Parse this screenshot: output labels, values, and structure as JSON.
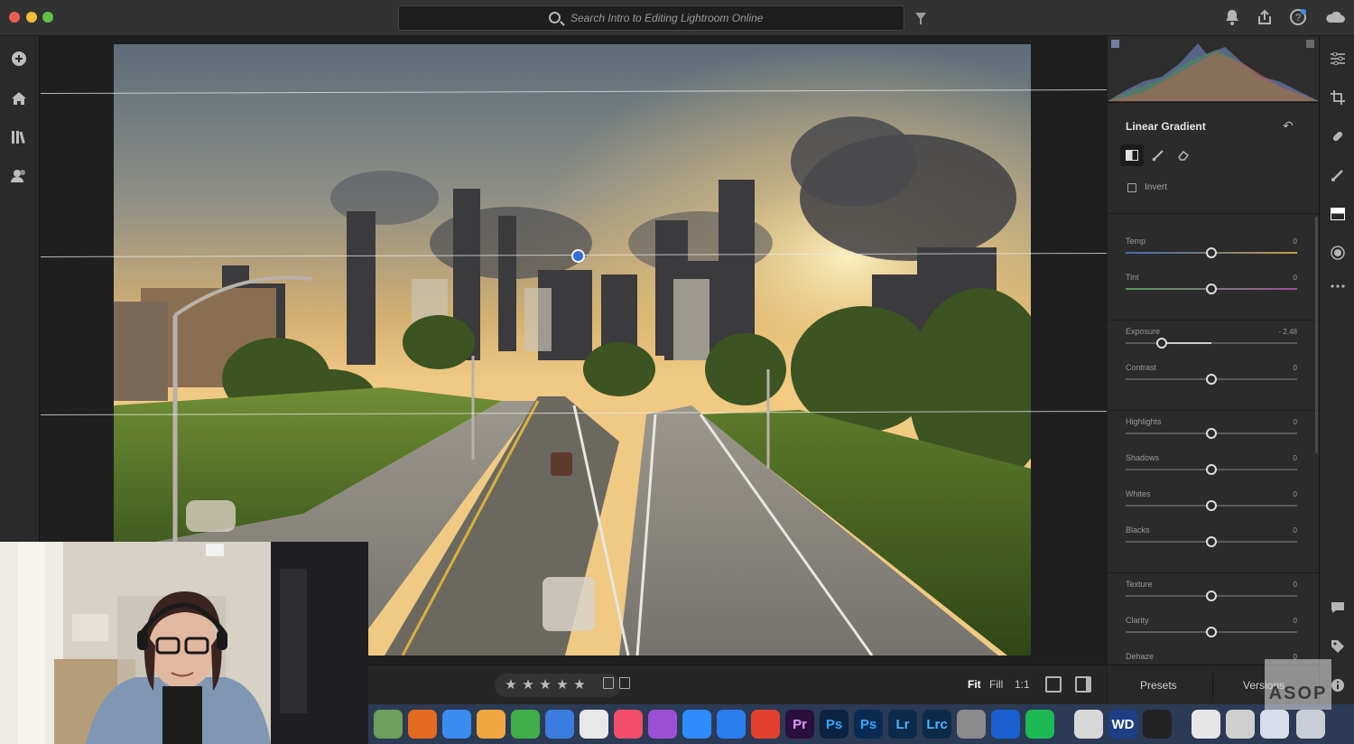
{
  "search": {
    "placeholder": "Search Intro to Editing Lightroom Online"
  },
  "panel": {
    "title": "Linear Gradient",
    "invert_label": "Invert",
    "sliders": [
      {
        "label": "Temp",
        "value": "0",
        "level": 0.5
      },
      {
        "label": "Tint",
        "value": "0",
        "level": 0.5
      },
      {
        "label": "Exposure",
        "value": "- 2.48",
        "level": 0.21
      },
      {
        "label": "Contrast",
        "value": "0",
        "level": 0.5
      },
      {
        "label": "Highlights",
        "value": "0",
        "level": 0.5
      },
      {
        "label": "Shadows",
        "value": "0",
        "level": 0.5
      },
      {
        "label": "Whites",
        "value": "0",
        "level": 0.5
      },
      {
        "label": "Blacks",
        "value": "0",
        "level": 0.5
      },
      {
        "label": "Texture",
        "value": "0",
        "level": 0.5
      },
      {
        "label": "Clarity",
        "value": "0",
        "level": 0.5
      },
      {
        "label": "Dehaze",
        "value": "0",
        "level": 0.5
      }
    ]
  },
  "toolbar": {
    "stars": [
      "★",
      "★",
      "★",
      "★",
      "★"
    ],
    "zoom_fit": "Fit",
    "zoom_fill": "Fill",
    "zoom_1to1": "1:1"
  },
  "panel_footer": {
    "presets": "Presets",
    "versions": "Versions"
  },
  "watermark": "ASOP",
  "dock": {
    "items": [
      {
        "name": "maps",
        "label": "",
        "color": "#6d9e5a"
      },
      {
        "name": "firefox",
        "label": "",
        "color": "#e46a1f"
      },
      {
        "name": "messages",
        "label": "",
        "color": "#3a8cf0"
      },
      {
        "name": "pages",
        "label": "",
        "color": "#f0a640"
      },
      {
        "name": "numbers",
        "label": "",
        "color": "#3fae4a"
      },
      {
        "name": "keynote",
        "label": "",
        "color": "#3a7be0"
      },
      {
        "name": "news",
        "label": "",
        "color": "#e8e8e8"
      },
      {
        "name": "music",
        "label": "",
        "color": "#f14d6a"
      },
      {
        "name": "podcasts",
        "label": "",
        "color": "#9c4fd6"
      },
      {
        "name": "zoom",
        "label": "",
        "color": "#2e8cff"
      },
      {
        "name": "app-store",
        "label": "",
        "color": "#2a7ef0"
      },
      {
        "name": "creative-cloud",
        "label": "",
        "color": "#e3402e"
      },
      {
        "name": "premiere",
        "label": "Pr",
        "color": "#2a0f3d"
      },
      {
        "name": "photoshop",
        "label": "Ps",
        "color": "#0b2240"
      },
      {
        "name": "photoshop-2",
        "label": "Ps",
        "color": "#0b2a52"
      },
      {
        "name": "lightroom",
        "label": "Lr",
        "color": "#0d2a4a"
      },
      {
        "name": "lightroom-classic",
        "label": "Lrc",
        "color": "#0d2a4a"
      },
      {
        "name": "system-preferences",
        "label": "",
        "color": "#8a8a8a"
      },
      {
        "name": "1password",
        "label": "",
        "color": "#1a5fd0"
      },
      {
        "name": "spotify",
        "label": "",
        "color": "#1db954"
      },
      {
        "name": "scanner",
        "label": "",
        "color": "#d8d8d8"
      },
      {
        "name": "wd",
        "label": "WD",
        "color": "#1c3f86"
      },
      {
        "name": "obs",
        "label": "",
        "color": "#222222"
      },
      {
        "name": "documents",
        "label": "",
        "color": "#e6e6e6"
      },
      {
        "name": "screenshot",
        "label": "",
        "color": "#cfcfcf"
      },
      {
        "name": "downloads",
        "label": "",
        "color": "#d7dde8"
      },
      {
        "name": "trash",
        "label": "",
        "color": "#c9ced6"
      }
    ]
  }
}
